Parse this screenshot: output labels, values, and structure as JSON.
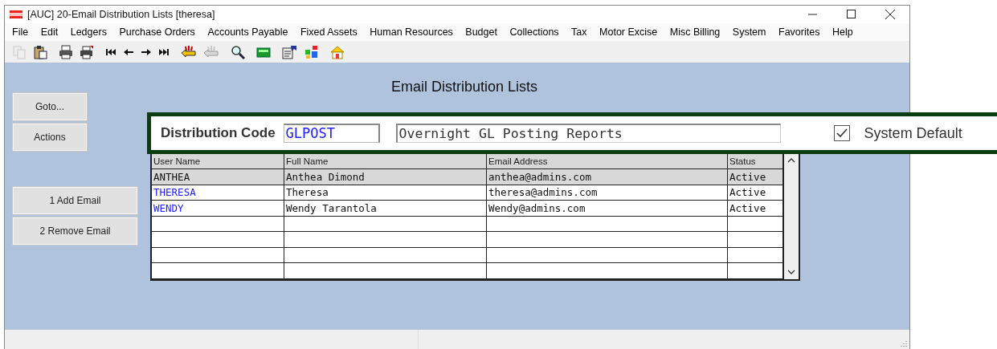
{
  "window": {
    "title": "[AUC] 20-Email Distribution Lists [theresa]"
  },
  "menu": [
    "File",
    "Edit",
    "Ledgers",
    "Purchase Orders",
    "Accounts Payable",
    "Fixed Assets",
    "Human Resources",
    "Budget",
    "Collections",
    "Tax",
    "Motor Excise",
    "Misc Billing",
    "System",
    "Favorites",
    "Help"
  ],
  "toolbar": [
    {
      "kind": "copy",
      "disabled": true
    },
    {
      "kind": "paste",
      "disabled": false
    },
    {
      "kind": "print",
      "disabled": false
    },
    {
      "kind": "print-preview",
      "disabled": false
    },
    {
      "kind": "first",
      "disabled": false
    },
    {
      "kind": "prev",
      "disabled": false
    },
    {
      "kind": "next",
      "disabled": false
    },
    {
      "kind": "last",
      "disabled": false
    },
    {
      "kind": "hand",
      "disabled": false
    },
    {
      "kind": "hand",
      "disabled": true
    },
    {
      "kind": "search",
      "disabled": false
    },
    {
      "kind": "calculator",
      "disabled": false
    },
    {
      "kind": "form",
      "disabled": false
    },
    {
      "kind": "blocks",
      "disabled": false
    },
    {
      "kind": "home",
      "disabled": false
    }
  ],
  "screen_title": "Email Distribution Lists",
  "side_buttons": [
    {
      "label": "Goto...",
      "kind": "nav"
    },
    {
      "label": "Actions",
      "kind": "nav"
    },
    {
      "label": "1 Add Email",
      "kind": "action"
    },
    {
      "label": "2 Remove Email",
      "kind": "action"
    }
  ],
  "header": {
    "code_label": "Distribution Code",
    "code": "GLPOST",
    "description": "Overnight GL Posting Reports",
    "system_default": {
      "label": "System Default",
      "checked": true
    }
  },
  "table": {
    "columns": [
      "User Name",
      "Full Name",
      "Email Address",
      "Status"
    ],
    "rows": [
      {
        "selected": true,
        "cells": [
          "ANTHEA",
          "Anthea Dimond",
          "anthea@admins.com",
          "Active"
        ]
      },
      {
        "selected": false,
        "cells": [
          "THERESA",
          "Theresa",
          "theresa@admins.com",
          "Active"
        ]
      },
      {
        "selected": false,
        "cells": [
          "WENDY",
          "Wendy Tarantola",
          "Wendy@admins.com",
          "Active"
        ]
      }
    ]
  }
}
